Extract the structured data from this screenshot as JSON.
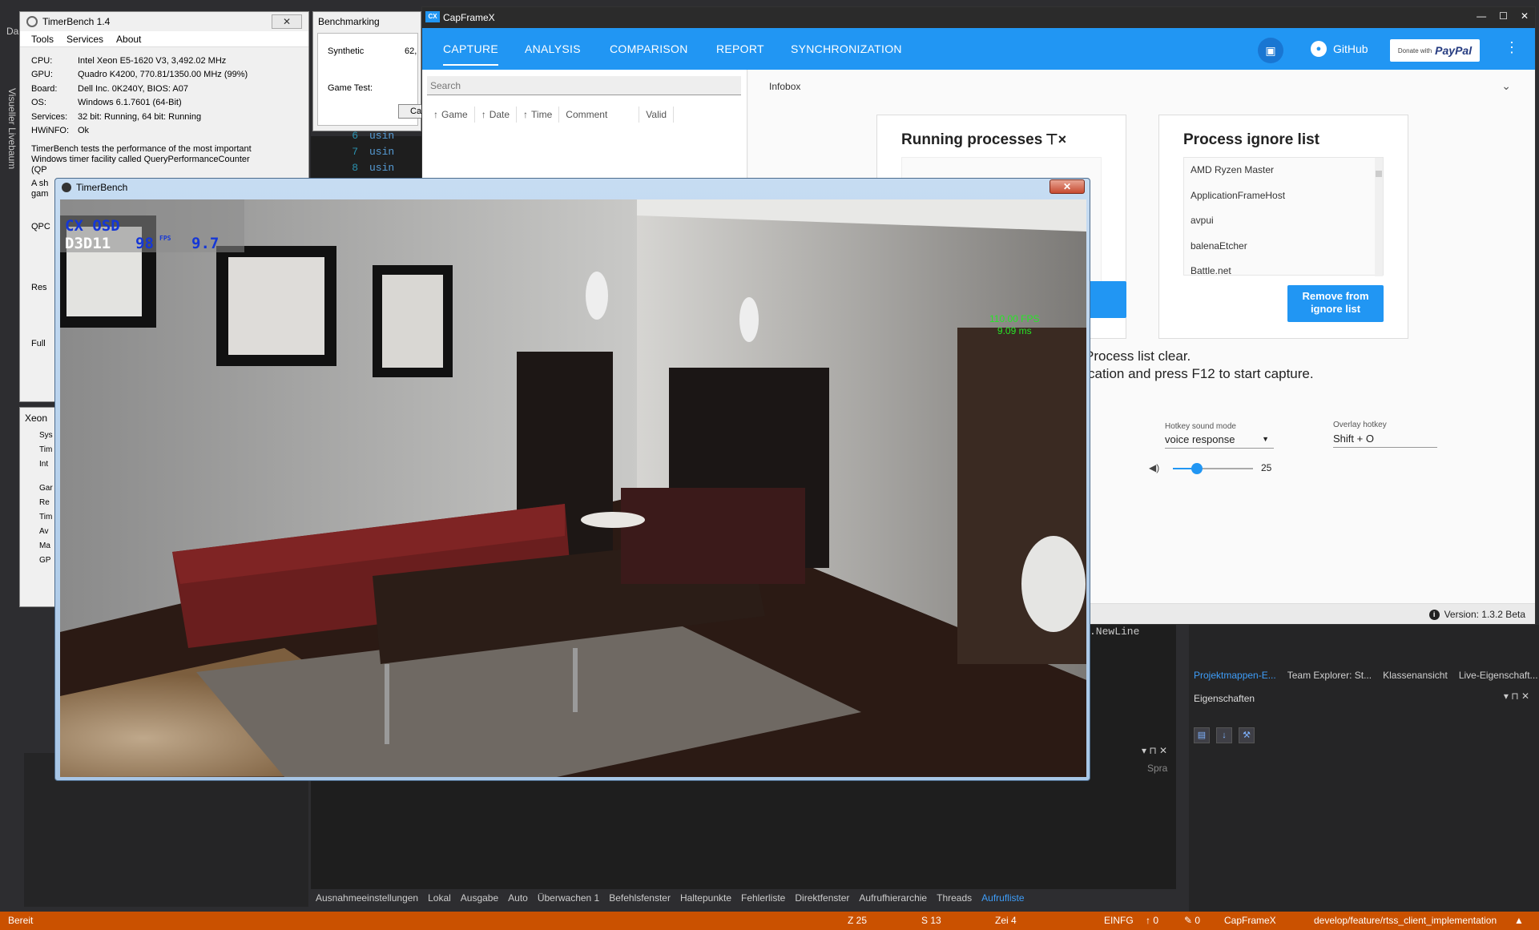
{
  "vs": {
    "left_label": "Da",
    "vertical_label": "Visueller Livebaum",
    "code_lines": [
      {
        "n": "6",
        "kw": "usin"
      },
      {
        "n": "7",
        "kw": "usin"
      },
      {
        "n": "8",
        "kw": "usin"
      }
    ],
    "newline_text": ".NewLine",
    "right_tabs": [
      "Projektmappen-E...",
      "Team Explorer: St...",
      "Klassenansicht",
      "Live-Eigenschaft..."
    ],
    "properties_title": "Eigenschaften",
    "properties_ctrls": "▾ ⊓ ✕",
    "sp_label": "Spra",
    "float_ctrls": "▾ ⊓ ✕",
    "bottom_tabs": [
      "Ausnahmeeinstellungen",
      "Lokal",
      "Ausgabe",
      "Auto",
      "Überwachen 1",
      "Befehlsfenster",
      "Haltepunkte",
      "Fehlerliste",
      "Direktfenster",
      "Aufrufhierarchie",
      "Threads",
      "Aufrufliste"
    ],
    "status": {
      "ready": "Bereit",
      "line": "Z 25",
      "col": "S 13",
      "char": "Zei 4",
      "mode": "EINFG",
      "up": "↑ 0",
      "pen": "✎ 0",
      "repo": "CapFrameX",
      "branch": "develop/feature/rtss_client_implementation",
      "caret": "▲"
    }
  },
  "timerbench": {
    "title": "TimerBench 1.4",
    "close": "✕",
    "menu": [
      "Tools",
      "Services",
      "About"
    ],
    "info": [
      {
        "k": "CPU:",
        "v": "Intel Xeon E5-1620 V3, 3,492.02 MHz"
      },
      {
        "k": "GPU:",
        "v": "Quadro K4200, 770.81/1350.00 MHz (99%)"
      },
      {
        "k": "Board:",
        "v": "Dell Inc. 0K240Y, BIOS: A07"
      },
      {
        "k": "OS:",
        "v": "Windows 6.1.7601 (64-Bit)"
      },
      {
        "k": "Services:",
        "v": "32 bit: Running, 64 bit: Running"
      },
      {
        "k": "HWiNFO:",
        "v": "Ok"
      }
    ],
    "desc_1": "TimerBench tests the performance of the most important",
    "desc_2": "Windows timer facility called QueryPerformanceCounter",
    "desc_3": "(QP",
    "desc_4": "A sh",
    "desc_5": "gam",
    "label_qpc": "QPC",
    "label_res": "Res",
    "label_full": "Full"
  },
  "xeon": {
    "title": "Xeon",
    "items": [
      "Sys",
      "Tim",
      "Int",
      "Gar",
      "Re",
      "Tim",
      "Av",
      "Ma",
      "GP"
    ]
  },
  "benchmarking": {
    "title": "Benchmarking",
    "synthetic": "Synthetic",
    "synthetic_val": "62,",
    "game_test": "Game Test:",
    "cancel": "Ca"
  },
  "capframex": {
    "title": "CapFrameX",
    "logo": "CX",
    "tabs": [
      "CAPTURE",
      "ANALYSIS",
      "COMPARISON",
      "REPORT",
      "SYNCHRONIZATION"
    ],
    "github": "GitHub",
    "paypal_small": "Donate with",
    "paypal": "PayPal",
    "search_placeholder": "Search",
    "columns": [
      "Game",
      "Date",
      "Time",
      "Comment",
      "Valid"
    ],
    "infobox": "Infobox",
    "running_processes": "Running processes",
    "process_ignore_list": "Process ignore list",
    "ignore_items": [
      "AMD Ryzen Master",
      "ApplicationFrameHost",
      "avpui",
      "balenaEtcher",
      "Battle.net"
    ],
    "remove_button_l1": "Remove from",
    "remove_button_l2": "ignore list",
    "msg_line_1": "Process list clear.",
    "msg_line_2": "cation and press  F12 to start capture.",
    "hotkey_sound_label": "Hotkey sound mode",
    "hotkey_sound_value": "voice response",
    "volume": "25",
    "overlay_hotkey_label": "Overlay hotkey",
    "overlay_hotkey_value": "Shift + O",
    "version": "Version: 1.3.2 Beta",
    "volume_fraction": 0.3
  },
  "render": {
    "title": "TimerBench",
    "close": "✕",
    "osd_line1": "CX OSD",
    "osd_api": "D3D11",
    "osd_fps": "98",
    "osd_fps_unit": "FPS",
    "osd_ms": "9.7",
    "overlay_fps": "110.00 FPS",
    "overlay_ms": "9.09 ms"
  }
}
